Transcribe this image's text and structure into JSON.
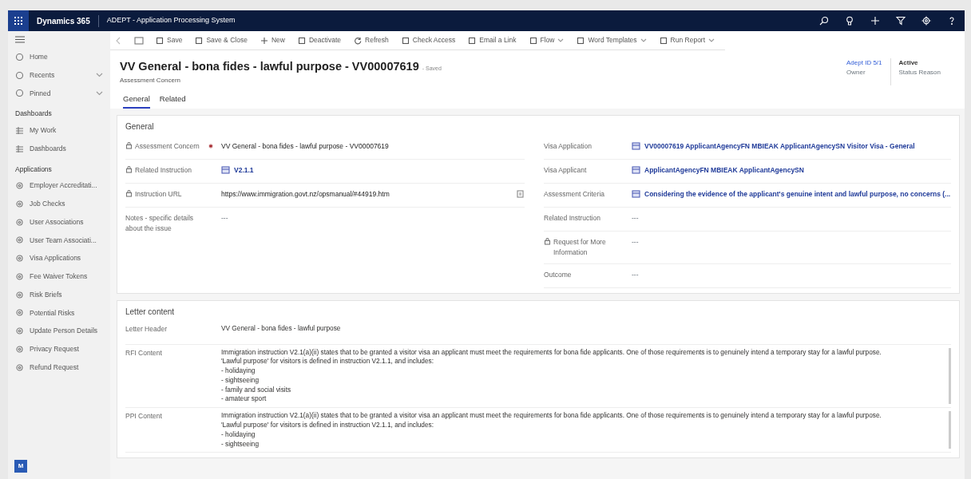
{
  "topbar": {
    "app_name": "Dynamics 365",
    "title": "ADEPT - Application Processing System"
  },
  "sidebar": {
    "top_items": [
      {
        "label": "Home",
        "kind": "link"
      },
      {
        "label": "Recents",
        "kind": "group",
        "expanded": false
      },
      {
        "label": "Pinned",
        "kind": "group",
        "expanded": false
      }
    ],
    "sections": [
      {
        "title": "Dashboards",
        "items": [
          {
            "label": "My Work"
          },
          {
            "label": "Dashboards"
          }
        ]
      },
      {
        "title": "Applications",
        "items": [
          {
            "label": "Employer Accreditati..."
          },
          {
            "label": "Job Checks"
          },
          {
            "label": "User Associations"
          },
          {
            "label": "User Team Associati..."
          },
          {
            "label": "Visa Applications"
          },
          {
            "label": "Fee Waiver Tokens"
          },
          {
            "label": "Risk Briefs"
          },
          {
            "label": "Potential Risks"
          },
          {
            "label": "Update Person Details"
          },
          {
            "label": "Privacy Request"
          },
          {
            "label": "Refund Request"
          }
        ]
      }
    ],
    "area_badge": "M"
  },
  "commands": [
    {
      "label": "Save",
      "dropdown": false
    },
    {
      "label": "Save & Close",
      "dropdown": false
    },
    {
      "label": "New",
      "dropdown": false
    },
    {
      "label": "Deactivate",
      "dropdown": false
    },
    {
      "label": "Refresh",
      "dropdown": false
    },
    {
      "label": "Check Access",
      "dropdown": false
    },
    {
      "label": "Email a Link",
      "dropdown": false
    },
    {
      "label": "Flow",
      "dropdown": true
    },
    {
      "label": "Word Templates",
      "dropdown": true
    },
    {
      "label": "Run Report",
      "dropdown": true
    }
  ],
  "header": {
    "title": "VV General - bona fides - lawful purpose - VV00007619",
    "save_status": "- Saved",
    "entity": "Assessment Concern",
    "fields": [
      {
        "value": "Adept ID 5/1",
        "label": "Owner",
        "kind": "link"
      },
      {
        "value": "Active",
        "label": "Status Reason",
        "kind": "text"
      }
    ]
  },
  "tabs": [
    {
      "label": "General",
      "selected": true
    },
    {
      "label": "Related",
      "selected": false
    }
  ],
  "general": {
    "title": "General",
    "left_fields": [
      {
        "label": "Assessment Concern",
        "locked": true,
        "required": true,
        "kind": "text",
        "value": "VV General - bona fides - lawful purpose - VV00007619"
      },
      {
        "label": "Related Instruction",
        "locked": true,
        "required": false,
        "kind": "lookup",
        "value": "V2.1.1"
      },
      {
        "label": "Instruction URL",
        "locked": true,
        "required": false,
        "kind": "url",
        "value": "https://www.immigration.govt.nz/opsmanual/#44919.htm"
      },
      {
        "label": "Notes - specific details about the issue",
        "locked": false,
        "required": false,
        "kind": "empty",
        "value": "---"
      }
    ],
    "right_fields": [
      {
        "label": "Visa Application",
        "locked": false,
        "kind": "lookup",
        "value": "VV00007619 ApplicantAgencyFN MBIEAK ApplicantAgencySN Visitor Visa - General"
      },
      {
        "label": "Visa Applicant",
        "locked": false,
        "kind": "lookup",
        "value": "ApplicantAgencyFN MBIEAK ApplicantAgencySN"
      },
      {
        "label": "Assessment Criteria",
        "locked": false,
        "kind": "lookup",
        "value": "Considering the evidence of the applicant's genuine intent and lawful purpose, no concerns (..."
      },
      {
        "label": "Related Instruction",
        "locked": false,
        "kind": "empty",
        "value": "---"
      },
      {
        "label": "Request for More Information",
        "locked": true,
        "kind": "empty",
        "value": "---"
      },
      {
        "label": "Outcome",
        "locked": false,
        "kind": "empty",
        "value": "---"
      }
    ]
  },
  "letter": {
    "title": "Letter content",
    "fields": [
      {
        "label": "Letter Header",
        "kind": "text",
        "lines": [
          "VV General - bona fides - lawful purpose"
        ]
      },
      {
        "label": "RFI Content",
        "kind": "multiline",
        "lines": [
          "Immigration instruction V2.1(a)(ii) states that to be granted a visitor visa an applicant must meet the requirements for bona fide applicants. One of those requirements is to genuinely intend a temporary stay for a lawful purpose.",
          "'Lawful purpose' for visitors is defined in instruction V2.1.1, and includes:",
          "- holidaying",
          "- sightseeing",
          "- family and social visits",
          "- amateur sport"
        ]
      },
      {
        "label": "PPI Content",
        "kind": "multiline",
        "lines": [
          "Immigration instruction V2.1(a)(ii) states that to be granted a visitor visa an applicant must meet the requirements for bona fide applicants. One of those requirements is to genuinely intend a temporary stay for a lawful purpose.",
          "'Lawful purpose' for visitors is defined in instruction V2.1.1, and includes:",
          "- holidaying",
          "- sightseeing"
        ]
      }
    ]
  }
}
